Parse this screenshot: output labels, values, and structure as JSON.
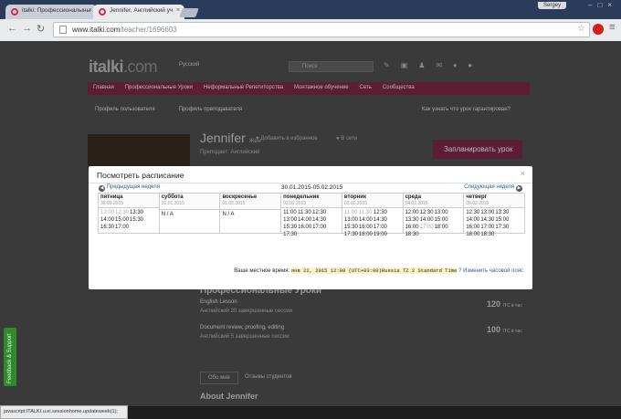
{
  "browser": {
    "tabs": [
      {
        "label": "italki: Профессионалыны",
        "active": false
      },
      {
        "label": "Jennifer, Английский уч",
        "active": true
      }
    ],
    "user": "Sergey",
    "url_host": "www.italki.com",
    "url_path": "/teacher/1696603",
    "status_text": "javascript:ITALKI.u.ei.sessionhome.updateweek(1);"
  },
  "site": {
    "logo_main": "italki",
    "logo_suffix": ".com",
    "language": "Русский",
    "search_placeholder": "Поиск",
    "nav": [
      "Главная",
      "Профессиональные Уроки",
      "Неформальные Репетиторства",
      "Монтажное обучение",
      "Сеть",
      "Сообщества"
    ],
    "subnav": [
      "Профиль пользователя",
      "Профиль преподавателя"
    ],
    "howto": "Как узнать что урок гарантирован?",
    "teacher_name": "Jennifer",
    "teacher_gender": "Жен",
    "add_fav": "Добавить в избранное",
    "online": "В сети",
    "teaches": "Преподает: Английский",
    "book_button": "Запланировать урок",
    "section_title": "Профессиональные Уроки",
    "lessons": [
      {
        "title": "English Lesson",
        "meta": "Английский    20 завершенные сессии"
      },
      {
        "title": "Document review, proofing, editing",
        "meta": "Английский    5 завершенные сессии"
      }
    ],
    "prices": [
      {
        "value": "120",
        "unit": "ITC в час"
      },
      {
        "value": "100",
        "unit": "ITC в час"
      }
    ],
    "tabs": [
      "Обо мне",
      "Отзывы студентов"
    ],
    "about_title": "About Jennifer",
    "feedback": "Feedback & Support"
  },
  "modal": {
    "title": "Посмотреть расписание",
    "close": "×",
    "prev_week": "Предыдущая неделя",
    "next_week": "Следующая неделя",
    "range": "30.01.2015-05.02.2015",
    "days": [
      {
        "name": "пятница",
        "date": "30.01.2015",
        "slots": [
          "12:00",
          "12:30",
          "13:30",
          "14:00",
          "15:00",
          "15:30",
          "16:30",
          "17:00"
        ],
        "grey": [
          0,
          1
        ]
      },
      {
        "name": "суббота",
        "date": "31.01.2015",
        "slots": [
          "N / A"
        ],
        "grey": []
      },
      {
        "name": "воскресенье",
        "date": "01.02.2015",
        "slots": [
          "N / A"
        ],
        "grey": []
      },
      {
        "name": "понедельник",
        "date": "02.02.2015",
        "slots": [
          "11:00",
          "11:30",
          "12:30",
          "13:00",
          "14:00",
          "14:30",
          "15:30",
          "16:00",
          "17:00",
          "17:30"
        ],
        "grey": []
      },
      {
        "name": "вторник",
        "date": "03.02.2015",
        "slots": [
          "11:00",
          "11:30",
          "12:30",
          "13:00",
          "14:00",
          "14:30",
          "15:30",
          "16:00",
          "17:00",
          "17:30",
          "18:00",
          "19:00"
        ],
        "grey": [
          0,
          1
        ]
      },
      {
        "name": "среда",
        "date": "04.02.2015",
        "slots": [
          "12:00",
          "12:30",
          "13:00",
          "13:30",
          "14:00",
          "15:00",
          "16:00",
          "17:00",
          "18:00",
          "18:30"
        ],
        "grey": [
          7
        ]
      },
      {
        "name": "четверг",
        "date": "05.02.2015",
        "slots": [
          "12:30",
          "13:00",
          "13:30",
          "14:00",
          "14:30",
          "15:00",
          "16:00",
          "17:00",
          "17:30",
          "18:00",
          "18:30"
        ],
        "grey": []
      }
    ],
    "local_time_label": "Ваше местное время:",
    "local_time_value": "янв 22, 2015 12:08 (UTC+03:00)Russia TZ 2 Standard Time",
    "change_tz": "Изменить часовой пояс"
  }
}
